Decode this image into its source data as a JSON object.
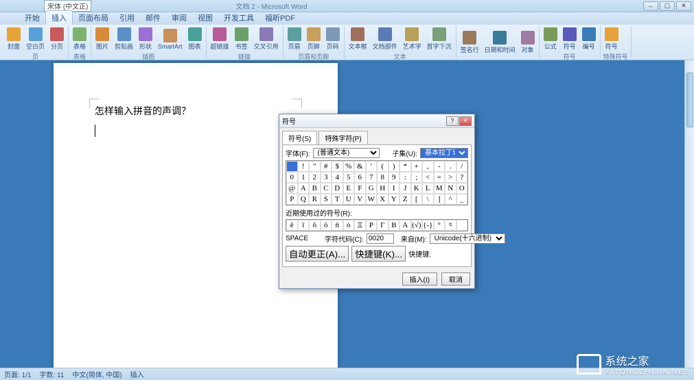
{
  "title": {
    "font_name": "宋体 (中文正)",
    "doc_title": "文档 2 - Microsoft Word"
  },
  "tabs": [
    "开始",
    "插入",
    "页面布局",
    "引用",
    "邮件",
    "审阅",
    "视图",
    "开发工具",
    "福昕PDF"
  ],
  "active_tab_index": 1,
  "ribbon_groups": [
    {
      "label": "页",
      "items": [
        "封面",
        "空白页",
        "分页"
      ]
    },
    {
      "label": "表格",
      "items": [
        "表格"
      ]
    },
    {
      "label": "插图",
      "items": [
        "图片",
        "剪贴画",
        "形状",
        "SmartArt",
        "图表"
      ]
    },
    {
      "label": "链接",
      "items": [
        "超链接",
        "书签",
        "交叉引用"
      ]
    },
    {
      "label": "页眉和页脚",
      "items": [
        "页眉",
        "页脚",
        "页码"
      ]
    },
    {
      "label": "文本",
      "items": [
        "文本框",
        "文档部件",
        "艺术字",
        "首字下沉"
      ]
    },
    {
      "label": "",
      "items": [
        "签名行",
        "日期和时间",
        "对象"
      ]
    },
    {
      "label": "符号",
      "items": [
        "公式",
        "符号",
        "编号"
      ]
    },
    {
      "label": "特殊符号",
      "items": [
        "符号"
      ]
    }
  ],
  "ribbon_colors": [
    "#e7a23a",
    "#5aa0d8",
    "#c85a5a",
    "#7fb36b",
    "#d88b3a",
    "#5a8fc8",
    "#9a6fd8",
    "#c8905a",
    "#4aa09a",
    "#b85a9a",
    "#6aa06a",
    "#8a7ab8",
    "#5aa0a0",
    "#c8a05a",
    "#7a9ab8",
    "#a0705a",
    "#5a7ab8",
    "#b8a05a",
    "#7aa07a",
    "#9a7a5a",
    "#3a7a9a",
    "#a07aa0",
    "#7a9a5a",
    "#5a5ab8",
    "#3a7ab8"
  ],
  "document": {
    "text": "怎样输入拼音的声调？"
  },
  "dialog": {
    "title": "符号",
    "tabs": [
      "符号(S)",
      "特殊字符(P)"
    ],
    "font_label": "字体(F):",
    "font_value": "(普通文本)",
    "subset_label": "子集(U):",
    "subset_value": "基本拉丁语",
    "grid": [
      [
        " ",
        "!",
        "\"",
        "#",
        "$",
        "%",
        "&",
        "'",
        "(",
        ")",
        "*",
        "+",
        ",",
        "-",
        ".",
        "/"
      ],
      [
        "0",
        "1",
        "2",
        "3",
        "4",
        "5",
        "6",
        "7",
        "8",
        "9",
        ":",
        ";",
        "<",
        "=",
        ">",
        "?"
      ],
      [
        "@",
        "A",
        "B",
        "C",
        "D",
        "E",
        "F",
        "G",
        "H",
        "I",
        "J",
        "K",
        "L",
        "M",
        "N",
        "O"
      ],
      [
        "P",
        "Q",
        "R",
        "S",
        "T",
        "U",
        "V",
        "W",
        "X",
        "Y",
        "Z",
        "[",
        "\\",
        "]",
        "^",
        "_"
      ]
    ],
    "recent_label": "近期使用过的符号(R):",
    "recent": [
      "ě",
      "ī",
      "ǒ",
      "ō",
      "ň",
      "ò",
      "Ξ",
      "Ρ",
      "Γ",
      "Β",
      "Α",
      "(√)",
      "{-}",
      "°",
      "⺀",
      ""
    ],
    "space_label": "SPACE",
    "char_code_label": "字符代码(C):",
    "char_code_value": "0020",
    "from_label": "来自(M):",
    "from_value": "Unicode(十六进制)",
    "autocorrect_btn": "自动更正(A)...",
    "shortcut_btn": "快捷键(K)...",
    "shortcut_label": "快捷键:",
    "insert_btn": "插入(I)",
    "cancel_btn": "取消"
  },
  "statusbar": {
    "page": "页面: 1/1",
    "words": "字数: 11",
    "lang": "中文(简体, 中国)",
    "mode": "插入"
  },
  "watermark": {
    "text": "系统之家",
    "url": "XITONGZHIJIA.NET"
  }
}
